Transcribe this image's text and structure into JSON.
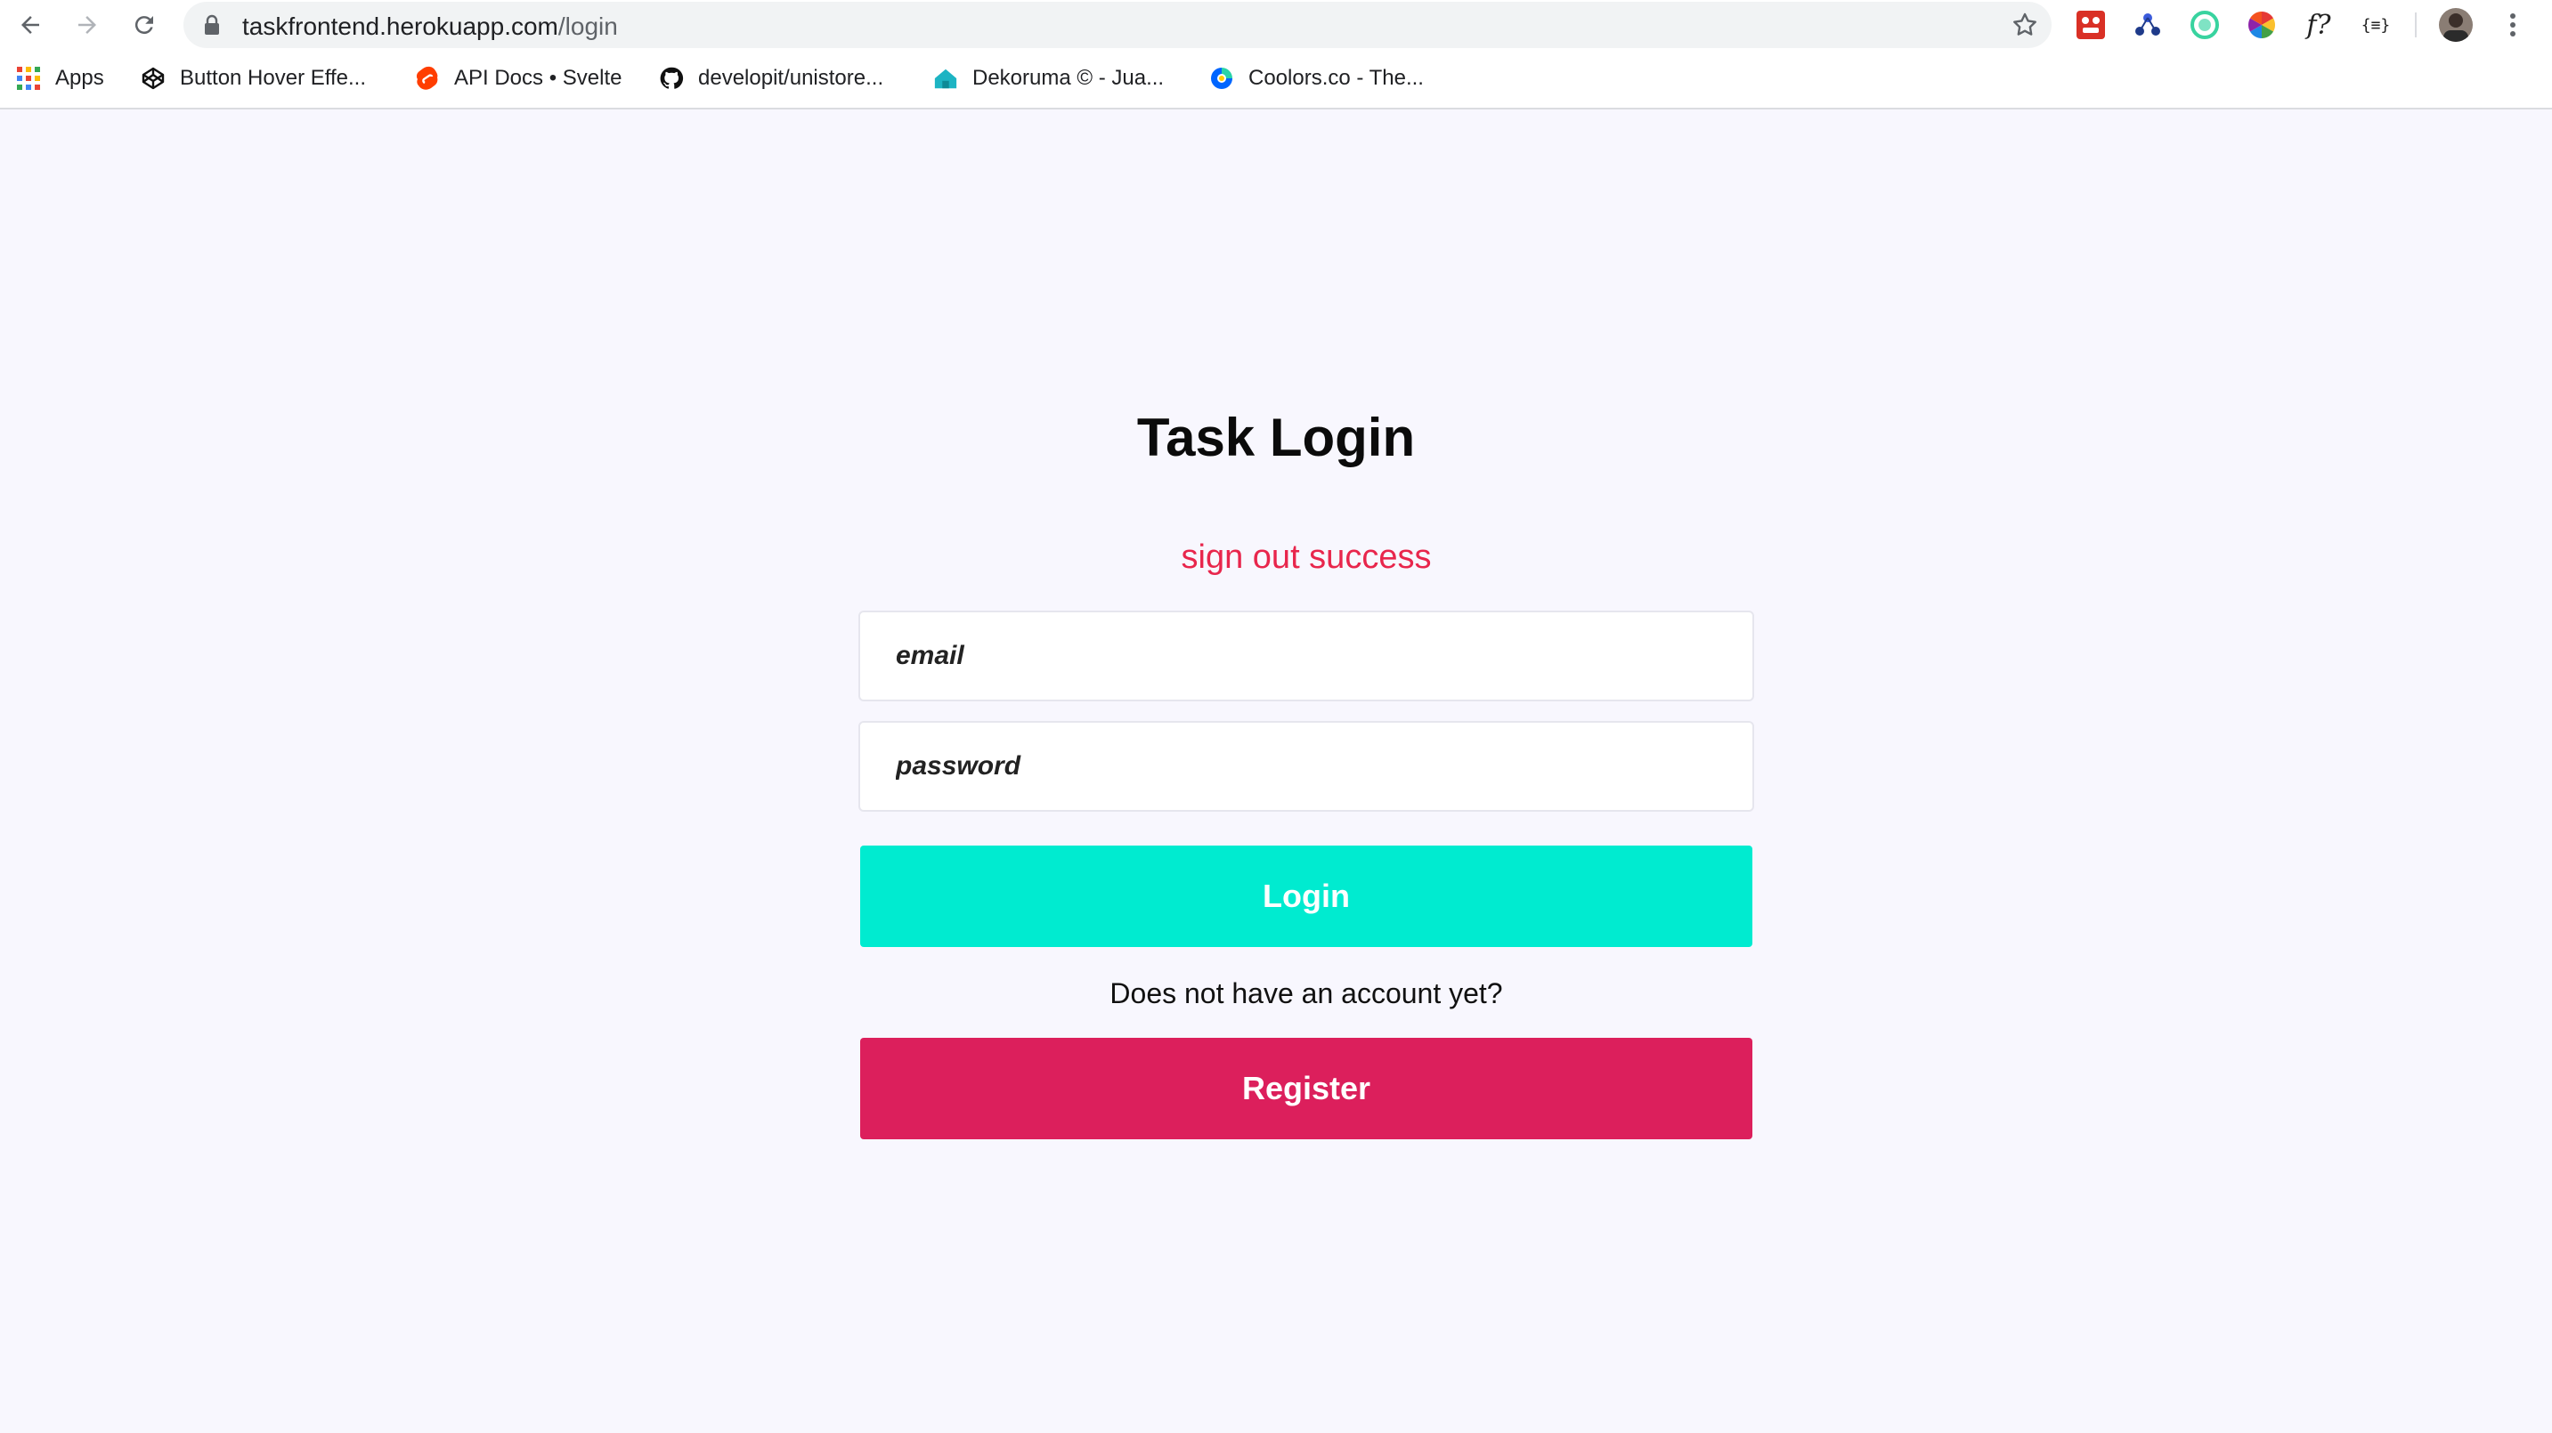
{
  "browser": {
    "url_host": "taskfrontend.herokuapp.com",
    "url_path": "/login",
    "ext_f_glyph": "f?",
    "ext_braces_glyph": "{≡}"
  },
  "bookmarks": [
    {
      "label": "Apps",
      "icon": "apps-grid-icon"
    },
    {
      "label": "Button Hover Effe...",
      "icon": "codepen-icon"
    },
    {
      "label": "API Docs • Svelte",
      "icon": "svelte-icon"
    },
    {
      "label": "developit/unistore...",
      "icon": "github-icon"
    },
    {
      "label": "Dekoruma © - Jua...",
      "icon": "dekoruma-house-icon"
    },
    {
      "label": "Coolors.co - The...",
      "icon": "coolors-icon"
    }
  ],
  "page": {
    "title": "Task Login",
    "status_message": "sign out success",
    "email_placeholder": "email",
    "password_placeholder": "password",
    "login_label": "Login",
    "no_account_prompt": "Does not have an account yet?",
    "register_label": "Register"
  },
  "colors": {
    "background": "#f8f7fe",
    "login_button": "#00ebd0",
    "register_button": "#dc1f5c",
    "status_text": "#e8264c"
  }
}
